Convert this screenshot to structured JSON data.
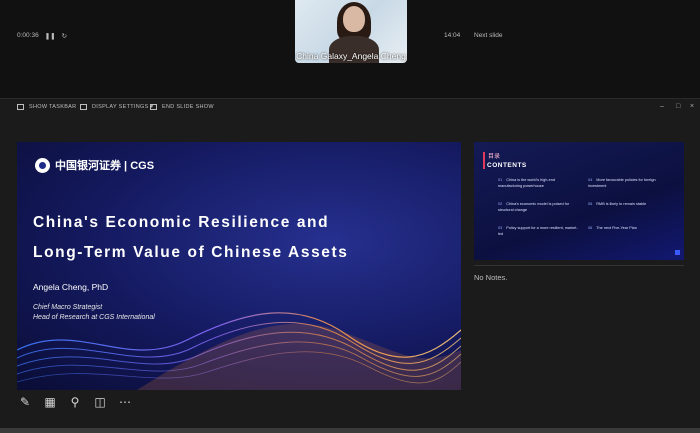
{
  "video": {
    "caption": "China Galaxy_Angela Cheng"
  },
  "toolbar": {
    "show_taskbar": "SHOW TASKBAR",
    "display_settings": "DISPLAY SETTINGS ▾",
    "end_slideshow": "END SLIDE SHOW"
  },
  "presenter": {
    "timer": "0:00:36",
    "clock": "14:04",
    "next_slide_label": "Next slide",
    "notes": "No Notes."
  },
  "slide": {
    "logo_text": "中国银河证券 | CGS",
    "title_line1": "China's Economic Resilience and",
    "title_line2": "Long-Term Value of Chinese Assets",
    "author": "Angela Cheng, PhD",
    "role_line1": "Chief Macro Strategist",
    "role_line2": "Head of Research at CGS International"
  },
  "next_slide": {
    "heading_cn": "目录",
    "heading_en": "CONTENTS",
    "items": [
      {
        "num": "01",
        "title": "China is the world's high-end manufacturing powerhouse"
      },
      {
        "num": "02",
        "title": "China's economic model is poised for structural change"
      },
      {
        "num": "03",
        "title": "Policy support for a more resilient, market-led"
      },
      {
        "num": "04",
        "title": "More favourable policies for foreign investment"
      },
      {
        "num": "05",
        "title": "RMB is likely to remain stable"
      },
      {
        "num": "06",
        "title": "The next Five-Year Plan"
      }
    ]
  },
  "colors": {
    "slide_bg": "#14195e",
    "accent": "#e23a5a"
  }
}
